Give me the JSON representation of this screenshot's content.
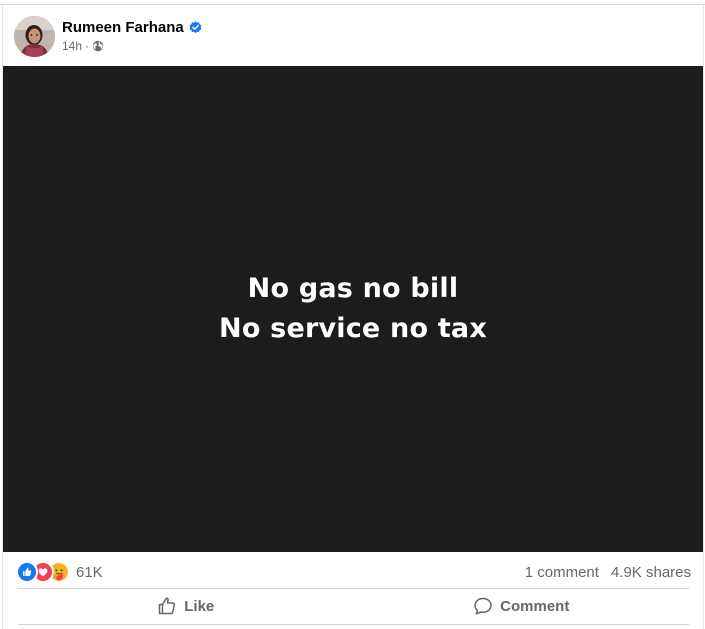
{
  "post": {
    "author": {
      "name": "Rumeen Farhana",
      "verified": true
    },
    "timestamp": "14h",
    "privacy": "globe-icon",
    "media": {
      "background": "#1c1c1c",
      "lines": [
        "No gas no bill",
        "No service no tax"
      ]
    },
    "reactions": {
      "types": [
        "like-icon",
        "love-icon",
        "care-icon"
      ],
      "count": "61K"
    },
    "stats": {
      "comments": "1 comment",
      "shares": "4.9K shares"
    },
    "actions": {
      "like_label": "Like",
      "comment_label": "Comment"
    }
  },
  "colors": {
    "accent": "#1877f2",
    "love": "#f33e58",
    "care": "#f7b125",
    "text_secondary": "#65676b"
  }
}
